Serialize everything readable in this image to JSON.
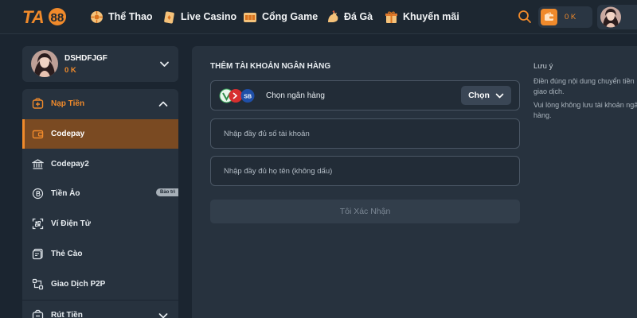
{
  "brand": {
    "logo_text": "TA88"
  },
  "nav": [
    {
      "label": "Thể Thao",
      "icon": "sports-ball-icon"
    },
    {
      "label": "Live Casino",
      "icon": "playing-card-icon"
    },
    {
      "label": "Cổng Game",
      "icon": "slot-machine-icon"
    },
    {
      "label": "Đá Gà",
      "icon": "rooster-icon"
    },
    {
      "label": "Khuyến mãi",
      "icon": "gift-icon"
    }
  ],
  "header": {
    "balance": "0 K"
  },
  "user": {
    "name": "DSHDFJGF",
    "balance": "0 K"
  },
  "menu": {
    "deposit_label": "Nạp Tiền",
    "items": [
      {
        "label": "Codepay",
        "icon": "wallet-icon",
        "active": true
      },
      {
        "label": "Codepay2",
        "icon": "bank-icon"
      },
      {
        "label": "Tiền Ảo",
        "icon": "bitcoin-icon",
        "badge": "Bảo trì"
      },
      {
        "label": "Ví Điện Tử",
        "icon": "qr-scan-icon"
      },
      {
        "label": "Thẻ Cào",
        "icon": "card-stack-icon"
      },
      {
        "label": "Giao Dịch P2P",
        "icon": "p2p-transfer-icon"
      }
    ],
    "withdraw_label": "Rút Tiền"
  },
  "form": {
    "title": "THÊM TÀI KHOẢN NGÂN HÀNG",
    "bank_label": "Chọn ngân hàng",
    "choose_button": "Chọn",
    "account_placeholder": "Nhập đầy đủ số tài khoản",
    "name_placeholder": "Nhập đầy đủ họ tên (không dấu)",
    "confirm_button": "Tôi Xác Nhận"
  },
  "notes": {
    "title": "Lưu ý",
    "lines": [
      "Điền đúng nội dung chuyển tiền giao dịch.",
      "Vui lòng không lưu tài khoản ngân hàng."
    ]
  },
  "colors": {
    "accent": "#f08a2b",
    "background": "#1b2530",
    "panel": "#27323e",
    "active_item": "#7a4a22"
  }
}
